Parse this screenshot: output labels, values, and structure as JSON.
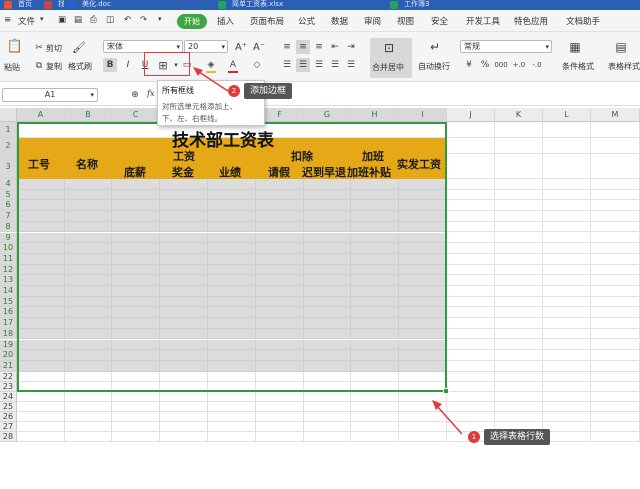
{
  "tabs": [
    {
      "label": "首页",
      "color": "#e8542f"
    },
    {
      "label": "找稻壳模板",
      "color": "#c8463a"
    },
    {
      "label": "美化.doc",
      "color": "#2a5fd0"
    },
    {
      "label": "简单工资表.xlsx",
      "color": "#23a45c"
    },
    {
      "label": "工作簿3",
      "color": "#23a45c"
    }
  ],
  "menu": {
    "file": "文件",
    "items": [
      "开始",
      "插入",
      "页面布局",
      "公式",
      "数据",
      "审阅",
      "视图",
      "安全",
      "开发工具",
      "特色应用",
      "文档助手"
    ]
  },
  "ribbon": {
    "paste": "粘贴",
    "cut": "剪切",
    "copy": "复制",
    "format_painter": "格式刷",
    "font_name": "宋体",
    "font_size": "20",
    "merge_center": "合并居中",
    "wrap": "自动换行",
    "number_format": "常规",
    "conditional_format": "条件格式",
    "table_style": "表格样式",
    "bold": "B",
    "italic": "I",
    "underline": "U"
  },
  "formula_bar": {
    "name_box": "A1",
    "fx": "fx"
  },
  "tooltip": {
    "title": "所有框线",
    "desc_line1": "对所选单元格添加上、",
    "desc_line2": "下、左、右框线。"
  },
  "callouts": [
    {
      "num": "2",
      "text": "添加边框"
    },
    {
      "num": "1",
      "text": "选择表格行数"
    }
  ],
  "columns": [
    "A",
    "B",
    "C",
    "D",
    "E",
    "F",
    "G",
    "H",
    "I",
    "J",
    "K",
    "L",
    "M"
  ],
  "rows": [
    "1",
    "2",
    "3",
    "4",
    "5",
    "6",
    "7",
    "8",
    "9",
    "10",
    "11",
    "12",
    "13",
    "14",
    "15",
    "16",
    "17",
    "18",
    "19",
    "20",
    "21",
    "22",
    "23",
    "24",
    "25",
    "26",
    "27",
    "28"
  ],
  "sheet": {
    "title": "技术部工资表",
    "h_gonghao": "工号",
    "h_mingcheng": "名称",
    "h_dixin": "底薪",
    "h_gongzi": "工资",
    "h_jiangjin": "奖金",
    "h_yeji": "业绩",
    "h_kouchu": "扣除",
    "h_qingjia": "请假",
    "h_chidao": "迟到早退",
    "h_jiaban": "加班",
    "h_jiabanbutie": "加班补贴",
    "h_shifa": "实发工资"
  },
  "colors": {
    "header_fill": "#e5a817",
    "selection": "#dcdcdc",
    "selection_border": "#2e9b3c",
    "accent_green": "#3ea541",
    "tab_blue": "#2b5fb3",
    "callout_red": "#e23a3a"
  }
}
